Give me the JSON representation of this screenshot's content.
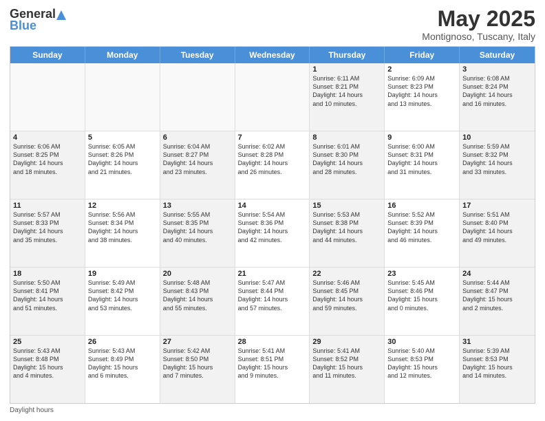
{
  "header": {
    "logo_general": "General",
    "logo_blue": "Blue",
    "month": "May 2025",
    "location": "Montignoso, Tuscany, Italy"
  },
  "days_of_week": [
    "Sunday",
    "Monday",
    "Tuesday",
    "Wednesday",
    "Thursday",
    "Friday",
    "Saturday"
  ],
  "rows": [
    [
      {
        "day": "",
        "text": "",
        "empty": true
      },
      {
        "day": "",
        "text": "",
        "empty": true
      },
      {
        "day": "",
        "text": "",
        "empty": true
      },
      {
        "day": "",
        "text": "",
        "empty": true
      },
      {
        "day": "1",
        "text": "Sunrise: 6:11 AM\nSunset: 8:21 PM\nDaylight: 14 hours\nand 10 minutes.",
        "empty": false
      },
      {
        "day": "2",
        "text": "Sunrise: 6:09 AM\nSunset: 8:23 PM\nDaylight: 14 hours\nand 13 minutes.",
        "empty": false
      },
      {
        "day": "3",
        "text": "Sunrise: 6:08 AM\nSunset: 8:24 PM\nDaylight: 14 hours\nand 16 minutes.",
        "empty": false
      }
    ],
    [
      {
        "day": "4",
        "text": "Sunrise: 6:06 AM\nSunset: 8:25 PM\nDaylight: 14 hours\nand 18 minutes.",
        "empty": false
      },
      {
        "day": "5",
        "text": "Sunrise: 6:05 AM\nSunset: 8:26 PM\nDaylight: 14 hours\nand 21 minutes.",
        "empty": false
      },
      {
        "day": "6",
        "text": "Sunrise: 6:04 AM\nSunset: 8:27 PM\nDaylight: 14 hours\nand 23 minutes.",
        "empty": false
      },
      {
        "day": "7",
        "text": "Sunrise: 6:02 AM\nSunset: 8:28 PM\nDaylight: 14 hours\nand 26 minutes.",
        "empty": false
      },
      {
        "day": "8",
        "text": "Sunrise: 6:01 AM\nSunset: 8:30 PM\nDaylight: 14 hours\nand 28 minutes.",
        "empty": false
      },
      {
        "day": "9",
        "text": "Sunrise: 6:00 AM\nSunset: 8:31 PM\nDaylight: 14 hours\nand 31 minutes.",
        "empty": false
      },
      {
        "day": "10",
        "text": "Sunrise: 5:59 AM\nSunset: 8:32 PM\nDaylight: 14 hours\nand 33 minutes.",
        "empty": false
      }
    ],
    [
      {
        "day": "11",
        "text": "Sunrise: 5:57 AM\nSunset: 8:33 PM\nDaylight: 14 hours\nand 35 minutes.",
        "empty": false
      },
      {
        "day": "12",
        "text": "Sunrise: 5:56 AM\nSunset: 8:34 PM\nDaylight: 14 hours\nand 38 minutes.",
        "empty": false
      },
      {
        "day": "13",
        "text": "Sunrise: 5:55 AM\nSunset: 8:35 PM\nDaylight: 14 hours\nand 40 minutes.",
        "empty": false
      },
      {
        "day": "14",
        "text": "Sunrise: 5:54 AM\nSunset: 8:36 PM\nDaylight: 14 hours\nand 42 minutes.",
        "empty": false
      },
      {
        "day": "15",
        "text": "Sunrise: 5:53 AM\nSunset: 8:38 PM\nDaylight: 14 hours\nand 44 minutes.",
        "empty": false
      },
      {
        "day": "16",
        "text": "Sunrise: 5:52 AM\nSunset: 8:39 PM\nDaylight: 14 hours\nand 46 minutes.",
        "empty": false
      },
      {
        "day": "17",
        "text": "Sunrise: 5:51 AM\nSunset: 8:40 PM\nDaylight: 14 hours\nand 49 minutes.",
        "empty": false
      }
    ],
    [
      {
        "day": "18",
        "text": "Sunrise: 5:50 AM\nSunset: 8:41 PM\nDaylight: 14 hours\nand 51 minutes.",
        "empty": false
      },
      {
        "day": "19",
        "text": "Sunrise: 5:49 AM\nSunset: 8:42 PM\nDaylight: 14 hours\nand 53 minutes.",
        "empty": false
      },
      {
        "day": "20",
        "text": "Sunrise: 5:48 AM\nSunset: 8:43 PM\nDaylight: 14 hours\nand 55 minutes.",
        "empty": false
      },
      {
        "day": "21",
        "text": "Sunrise: 5:47 AM\nSunset: 8:44 PM\nDaylight: 14 hours\nand 57 minutes.",
        "empty": false
      },
      {
        "day": "22",
        "text": "Sunrise: 5:46 AM\nSunset: 8:45 PM\nDaylight: 14 hours\nand 59 minutes.",
        "empty": false
      },
      {
        "day": "23",
        "text": "Sunrise: 5:45 AM\nSunset: 8:46 PM\nDaylight: 15 hours\nand 0 minutes.",
        "empty": false
      },
      {
        "day": "24",
        "text": "Sunrise: 5:44 AM\nSunset: 8:47 PM\nDaylight: 15 hours\nand 2 minutes.",
        "empty": false
      }
    ],
    [
      {
        "day": "25",
        "text": "Sunrise: 5:43 AM\nSunset: 8:48 PM\nDaylight: 15 hours\nand 4 minutes.",
        "empty": false
      },
      {
        "day": "26",
        "text": "Sunrise: 5:43 AM\nSunset: 8:49 PM\nDaylight: 15 hours\nand 6 minutes.",
        "empty": false
      },
      {
        "day": "27",
        "text": "Sunrise: 5:42 AM\nSunset: 8:50 PM\nDaylight: 15 hours\nand 7 minutes.",
        "empty": false
      },
      {
        "day": "28",
        "text": "Sunrise: 5:41 AM\nSunset: 8:51 PM\nDaylight: 15 hours\nand 9 minutes.",
        "empty": false
      },
      {
        "day": "29",
        "text": "Sunrise: 5:41 AM\nSunset: 8:52 PM\nDaylight: 15 hours\nand 11 minutes.",
        "empty": false
      },
      {
        "day": "30",
        "text": "Sunrise: 5:40 AM\nSunset: 8:53 PM\nDaylight: 15 hours\nand 12 minutes.",
        "empty": false
      },
      {
        "day": "31",
        "text": "Sunrise: 5:39 AM\nSunset: 8:53 PM\nDaylight: 15 hours\nand 14 minutes.",
        "empty": false
      }
    ]
  ],
  "footer": {
    "text": "Daylight hours"
  }
}
